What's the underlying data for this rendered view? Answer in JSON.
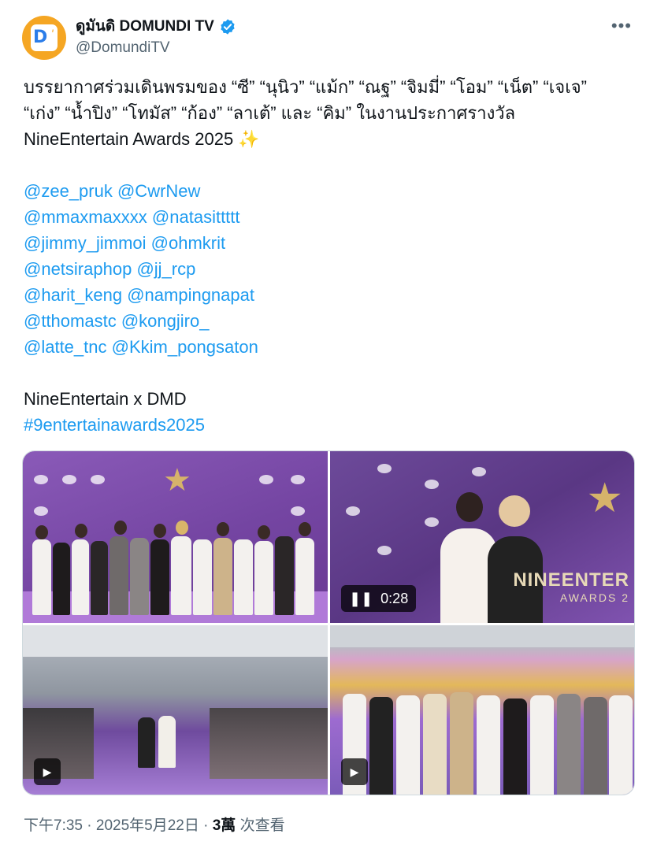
{
  "header": {
    "display_name": "ดูมันดิ DOMUNDI TV",
    "handle": "@DomundiTV",
    "more_label": "•••"
  },
  "tweet": {
    "line1": "บรรยากาศร่วมเดินพรมของ “ซี” “นุนิว” “แม้ก” “ณฐ” “จิมมี่” “โอม” “เน็ต” “เจเจ”",
    "line2": "“เก่ง” “น้ำปิง” “โทมัส” “ก้อง” “ลาเต้” และ “คิม” ในงานประกาศรางวัล",
    "line3": "NineEntertain Awards 2025",
    "sparkle": "✨",
    "mention_rows": [
      [
        "@zee_pruk",
        "@CwrNew"
      ],
      [
        "@mmaxmaxxxx",
        "@natasittttt"
      ],
      [
        "@jimmy_jimmoi",
        "@ohmkrit"
      ],
      [
        "@netsiraphop",
        "@jj_rcp"
      ],
      [
        "@harit_keng",
        "@nampingnapat"
      ],
      [
        "@tthomastc",
        "@kongjiro_"
      ],
      [
        "@latte_tnc",
        "@Kkim_pongsaton"
      ]
    ],
    "collab_line": "NineEntertain x DMD",
    "hashtag": "#9entertainawards2025"
  },
  "media": {
    "video_duration": "0:28",
    "brand_text": "NINEENTER",
    "brand_sub": "AWARDS 2"
  },
  "meta": {
    "time": "下午7:35",
    "sep1": " · ",
    "date": "2025年5月22日",
    "sep2": " · ",
    "views_count": "3萬",
    "views_label": " 次查看"
  },
  "colors": {
    "accent": "#1d9bf0",
    "secondary_text": "#536471",
    "avatar_bg": "#f5a623"
  }
}
